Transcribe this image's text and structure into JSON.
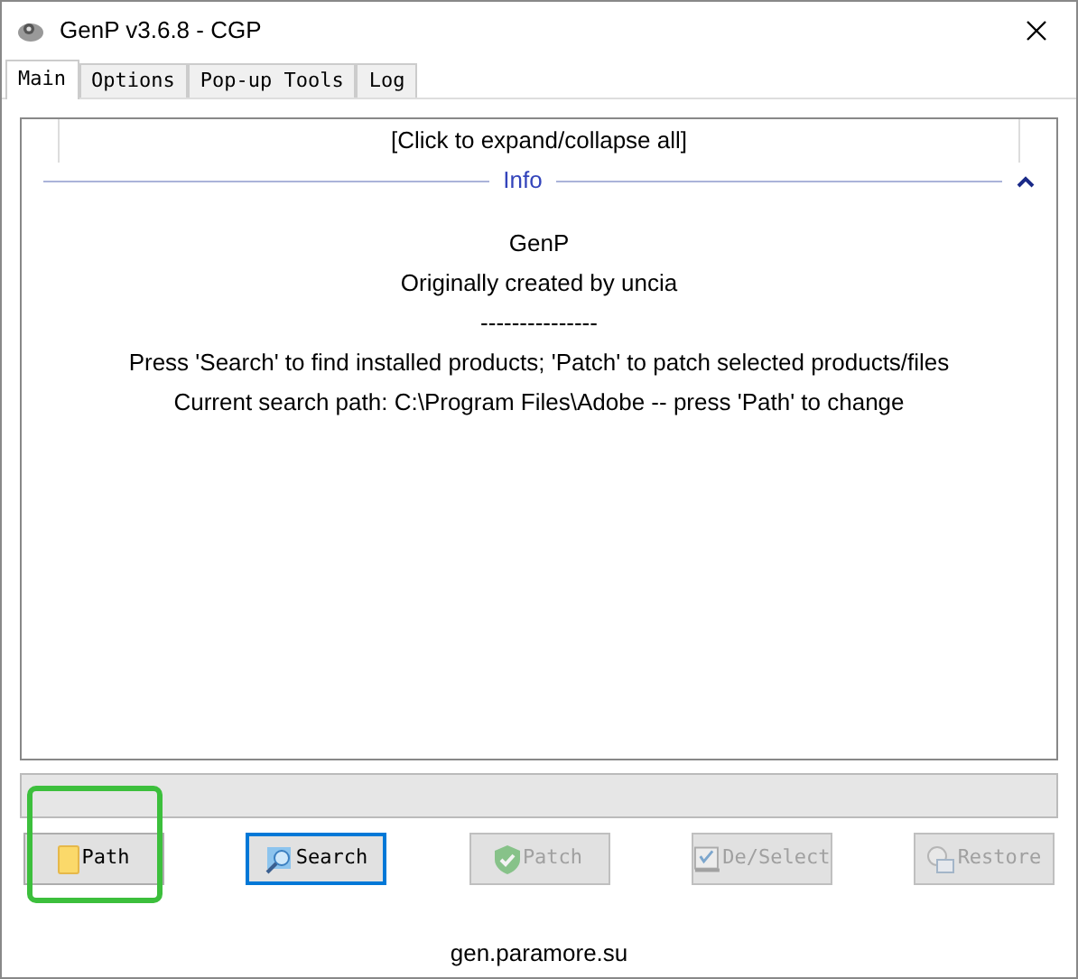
{
  "window": {
    "title": "GenP v3.6.8 - CGP"
  },
  "tabs": [
    {
      "label": "Main",
      "selected": true
    },
    {
      "label": "Options",
      "selected": false
    },
    {
      "label": "Pop-up Tools",
      "selected": false
    },
    {
      "label": "Log",
      "selected": false
    }
  ],
  "expand_all": "[Click to expand/collapse all]",
  "info_section": {
    "title": "Info",
    "expanded": true,
    "lines": [
      "GenP",
      "Originally created by uncia",
      "---------------",
      "Press 'Search' to find installed products; 'Patch' to patch selected products/files",
      "Current search path: C:\\Program Files\\Adobe -- press 'Path' to change"
    ]
  },
  "progress": {
    "level": 0
  },
  "buttons": [
    {
      "label": "Path",
      "kind": "folder",
      "disabled": false,
      "focused": false,
      "highlighted": true
    },
    {
      "label": "Search",
      "kind": "search",
      "disabled": false,
      "focused": true,
      "highlighted": false
    },
    {
      "label": "Patch",
      "kind": "shield",
      "disabled": true,
      "focused": false,
      "highlighted": false
    },
    {
      "label": "De/Select",
      "kind": "checklist",
      "disabled": true,
      "focused": false,
      "highlighted": false
    },
    {
      "label": "Restore",
      "kind": "restore",
      "disabled": true,
      "focused": false,
      "highlighted": false
    }
  ],
  "footer": "gen.paramore.su"
}
